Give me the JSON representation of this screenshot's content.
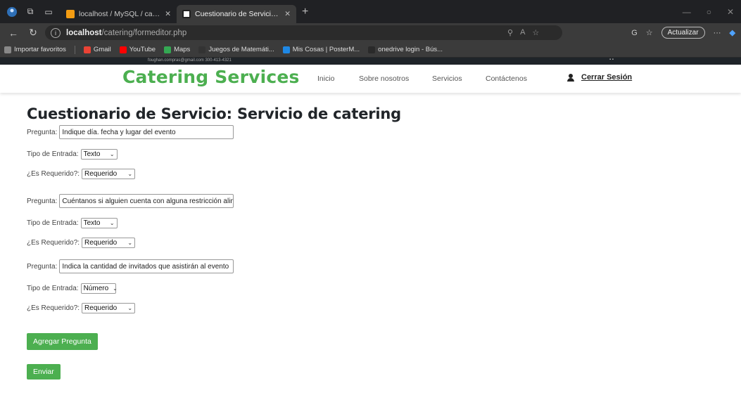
{
  "browser": {
    "tabs": [
      {
        "title": "localhost / MySQL / cateringdb /",
        "active": false
      },
      {
        "title": "Cuestionario de Servicio: Servicio",
        "active": true
      }
    ],
    "url_host": "localhost",
    "url_path": "/catering/formeditor.php",
    "update_label": "Actualizar",
    "bookmarks": [
      {
        "label": "Importar favoritos",
        "color": "#888888"
      },
      {
        "label": "Gmail",
        "color": "#ea4335"
      },
      {
        "label": "YouTube",
        "color": "#ff0000"
      },
      {
        "label": "Maps",
        "color": "#34a853"
      },
      {
        "label": "Juegos de Matemáti...",
        "color": "#333333"
      },
      {
        "label": "Mis Cosas | PosterM...",
        "color": "#1e88e5"
      },
      {
        "label": "onedrive login - Bús...",
        "color": "#2a2a2a"
      }
    ]
  },
  "site": {
    "contact": "foughan.compras@gmail.com   300-413-4321",
    "brand": "Catering Services",
    "menu": [
      "Inicio",
      "Sobre nosotros",
      "Servicios",
      "Contáctenos"
    ],
    "logout": "Cerrar Sesión",
    "brand_color": "#4caf50"
  },
  "form": {
    "title": "Cuestionario de Servicio: Servicio de catering",
    "question_label": "Pregunta:",
    "type_label": "Tipo de Entrada:",
    "required_label": "¿Es Requerido?:",
    "questions": [
      {
        "text": "Indique día. fecha y lugar del evento",
        "type": "Texto",
        "required": "Requerido"
      },
      {
        "text": "Cuéntanos si alguien cuenta con alguna restricción alimenticia",
        "type": "Texto",
        "required": "Requerido"
      },
      {
        "text": "Indica la cantidad de invitados que asistirán al evento",
        "type": "Número",
        "required": "Requerido"
      }
    ],
    "add_button": "Agregar Pregunta",
    "submit_button": "Enviar"
  }
}
